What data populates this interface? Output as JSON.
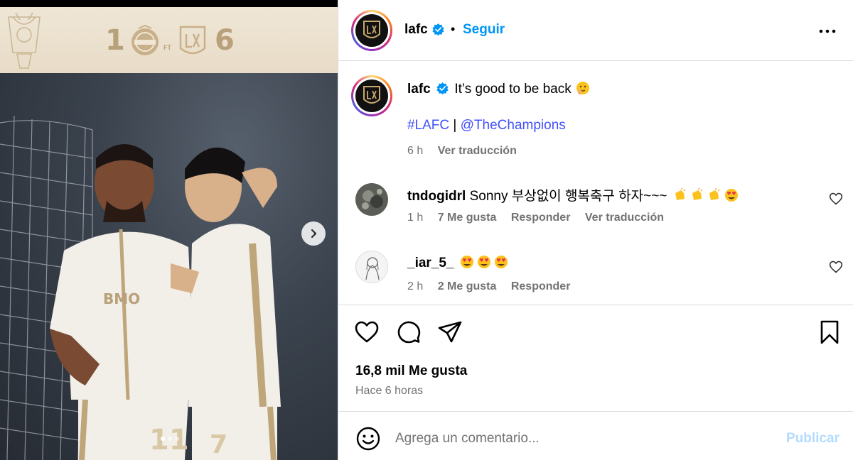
{
  "media": {
    "score": {
      "home": "1",
      "away": "6",
      "ft": "FT"
    },
    "carousel": {
      "dots": 3,
      "active_index": 0
    }
  },
  "header": {
    "username": "lafc",
    "verified": true,
    "separator": "•",
    "follow_label": "Seguir"
  },
  "caption": {
    "username": "lafc",
    "text": "It’s good to be back",
    "emoji_icon": "shushing-face-icon",
    "hashtag": "#LAFC",
    "separator": "|",
    "mention": "@TheChampions",
    "time": "6 h",
    "translate_label": "Ver traducción"
  },
  "comments": [
    {
      "username": "tndogidrl",
      "text": "Sonny 부상없이 행복축구 하자~~~",
      "emojis": [
        "clapping-hands",
        "clapping-hands",
        "clapping-hands",
        "heart-eyes"
      ],
      "time": "1 h",
      "likes": "7 Me gusta",
      "reply_label": "Responder",
      "translate_label": "Ver traducción"
    },
    {
      "username": "_iar_5_",
      "text": "",
      "emojis": [
        "heart-eyes",
        "heart-eyes",
        "heart-eyes"
      ],
      "time": "2 h",
      "likes": "2 Me gusta",
      "reply_label": "Responder"
    }
  ],
  "actions": {
    "likes_label": "16,8 mil Me gusta",
    "time_label": "Hace 6 horas"
  },
  "composer": {
    "placeholder": "Agrega un comentario...",
    "publish_label": "Publicar"
  },
  "colors": {
    "link": "#0095f6",
    "hashtag": "#4150f7",
    "muted": "#737373",
    "publish_disabled": "#b3dbff",
    "border": "#dbdbdb"
  }
}
